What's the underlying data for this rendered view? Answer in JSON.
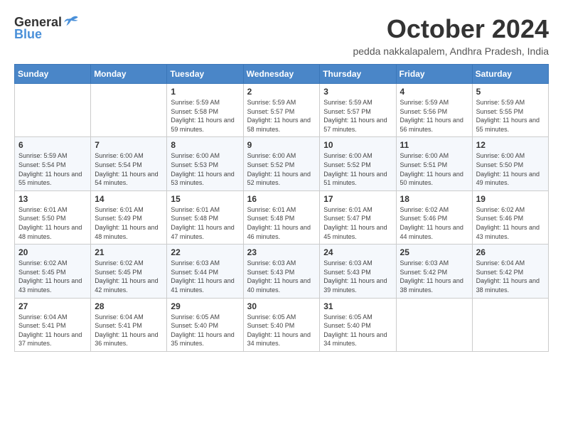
{
  "header": {
    "logo_line1": "General",
    "logo_line2": "Blue",
    "month_title": "October 2024",
    "location": "pedda nakkalapalem, Andhra Pradesh, India"
  },
  "days_of_week": [
    "Sunday",
    "Monday",
    "Tuesday",
    "Wednesday",
    "Thursday",
    "Friday",
    "Saturday"
  ],
  "weeks": [
    [
      {
        "day": "",
        "info": ""
      },
      {
        "day": "",
        "info": ""
      },
      {
        "day": "1",
        "info": "Sunrise: 5:59 AM\nSunset: 5:58 PM\nDaylight: 11 hours and 59 minutes."
      },
      {
        "day": "2",
        "info": "Sunrise: 5:59 AM\nSunset: 5:57 PM\nDaylight: 11 hours and 58 minutes."
      },
      {
        "day": "3",
        "info": "Sunrise: 5:59 AM\nSunset: 5:57 PM\nDaylight: 11 hours and 57 minutes."
      },
      {
        "day": "4",
        "info": "Sunrise: 5:59 AM\nSunset: 5:56 PM\nDaylight: 11 hours and 56 minutes."
      },
      {
        "day": "5",
        "info": "Sunrise: 5:59 AM\nSunset: 5:55 PM\nDaylight: 11 hours and 55 minutes."
      }
    ],
    [
      {
        "day": "6",
        "info": "Sunrise: 5:59 AM\nSunset: 5:54 PM\nDaylight: 11 hours and 55 minutes."
      },
      {
        "day": "7",
        "info": "Sunrise: 6:00 AM\nSunset: 5:54 PM\nDaylight: 11 hours and 54 minutes."
      },
      {
        "day": "8",
        "info": "Sunrise: 6:00 AM\nSunset: 5:53 PM\nDaylight: 11 hours and 53 minutes."
      },
      {
        "day": "9",
        "info": "Sunrise: 6:00 AM\nSunset: 5:52 PM\nDaylight: 11 hours and 52 minutes."
      },
      {
        "day": "10",
        "info": "Sunrise: 6:00 AM\nSunset: 5:52 PM\nDaylight: 11 hours and 51 minutes."
      },
      {
        "day": "11",
        "info": "Sunrise: 6:00 AM\nSunset: 5:51 PM\nDaylight: 11 hours and 50 minutes."
      },
      {
        "day": "12",
        "info": "Sunrise: 6:00 AM\nSunset: 5:50 PM\nDaylight: 11 hours and 49 minutes."
      }
    ],
    [
      {
        "day": "13",
        "info": "Sunrise: 6:01 AM\nSunset: 5:50 PM\nDaylight: 11 hours and 48 minutes."
      },
      {
        "day": "14",
        "info": "Sunrise: 6:01 AM\nSunset: 5:49 PM\nDaylight: 11 hours and 48 minutes."
      },
      {
        "day": "15",
        "info": "Sunrise: 6:01 AM\nSunset: 5:48 PM\nDaylight: 11 hours and 47 minutes."
      },
      {
        "day": "16",
        "info": "Sunrise: 6:01 AM\nSunset: 5:48 PM\nDaylight: 11 hours and 46 minutes."
      },
      {
        "day": "17",
        "info": "Sunrise: 6:01 AM\nSunset: 5:47 PM\nDaylight: 11 hours and 45 minutes."
      },
      {
        "day": "18",
        "info": "Sunrise: 6:02 AM\nSunset: 5:46 PM\nDaylight: 11 hours and 44 minutes."
      },
      {
        "day": "19",
        "info": "Sunrise: 6:02 AM\nSunset: 5:46 PM\nDaylight: 11 hours and 43 minutes."
      }
    ],
    [
      {
        "day": "20",
        "info": "Sunrise: 6:02 AM\nSunset: 5:45 PM\nDaylight: 11 hours and 43 minutes."
      },
      {
        "day": "21",
        "info": "Sunrise: 6:02 AM\nSunset: 5:45 PM\nDaylight: 11 hours and 42 minutes."
      },
      {
        "day": "22",
        "info": "Sunrise: 6:03 AM\nSunset: 5:44 PM\nDaylight: 11 hours and 41 minutes."
      },
      {
        "day": "23",
        "info": "Sunrise: 6:03 AM\nSunset: 5:43 PM\nDaylight: 11 hours and 40 minutes."
      },
      {
        "day": "24",
        "info": "Sunrise: 6:03 AM\nSunset: 5:43 PM\nDaylight: 11 hours and 39 minutes."
      },
      {
        "day": "25",
        "info": "Sunrise: 6:03 AM\nSunset: 5:42 PM\nDaylight: 11 hours and 38 minutes."
      },
      {
        "day": "26",
        "info": "Sunrise: 6:04 AM\nSunset: 5:42 PM\nDaylight: 11 hours and 38 minutes."
      }
    ],
    [
      {
        "day": "27",
        "info": "Sunrise: 6:04 AM\nSunset: 5:41 PM\nDaylight: 11 hours and 37 minutes."
      },
      {
        "day": "28",
        "info": "Sunrise: 6:04 AM\nSunset: 5:41 PM\nDaylight: 11 hours and 36 minutes."
      },
      {
        "day": "29",
        "info": "Sunrise: 6:05 AM\nSunset: 5:40 PM\nDaylight: 11 hours and 35 minutes."
      },
      {
        "day": "30",
        "info": "Sunrise: 6:05 AM\nSunset: 5:40 PM\nDaylight: 11 hours and 34 minutes."
      },
      {
        "day": "31",
        "info": "Sunrise: 6:05 AM\nSunset: 5:40 PM\nDaylight: 11 hours and 34 minutes."
      },
      {
        "day": "",
        "info": ""
      },
      {
        "day": "",
        "info": ""
      }
    ]
  ]
}
